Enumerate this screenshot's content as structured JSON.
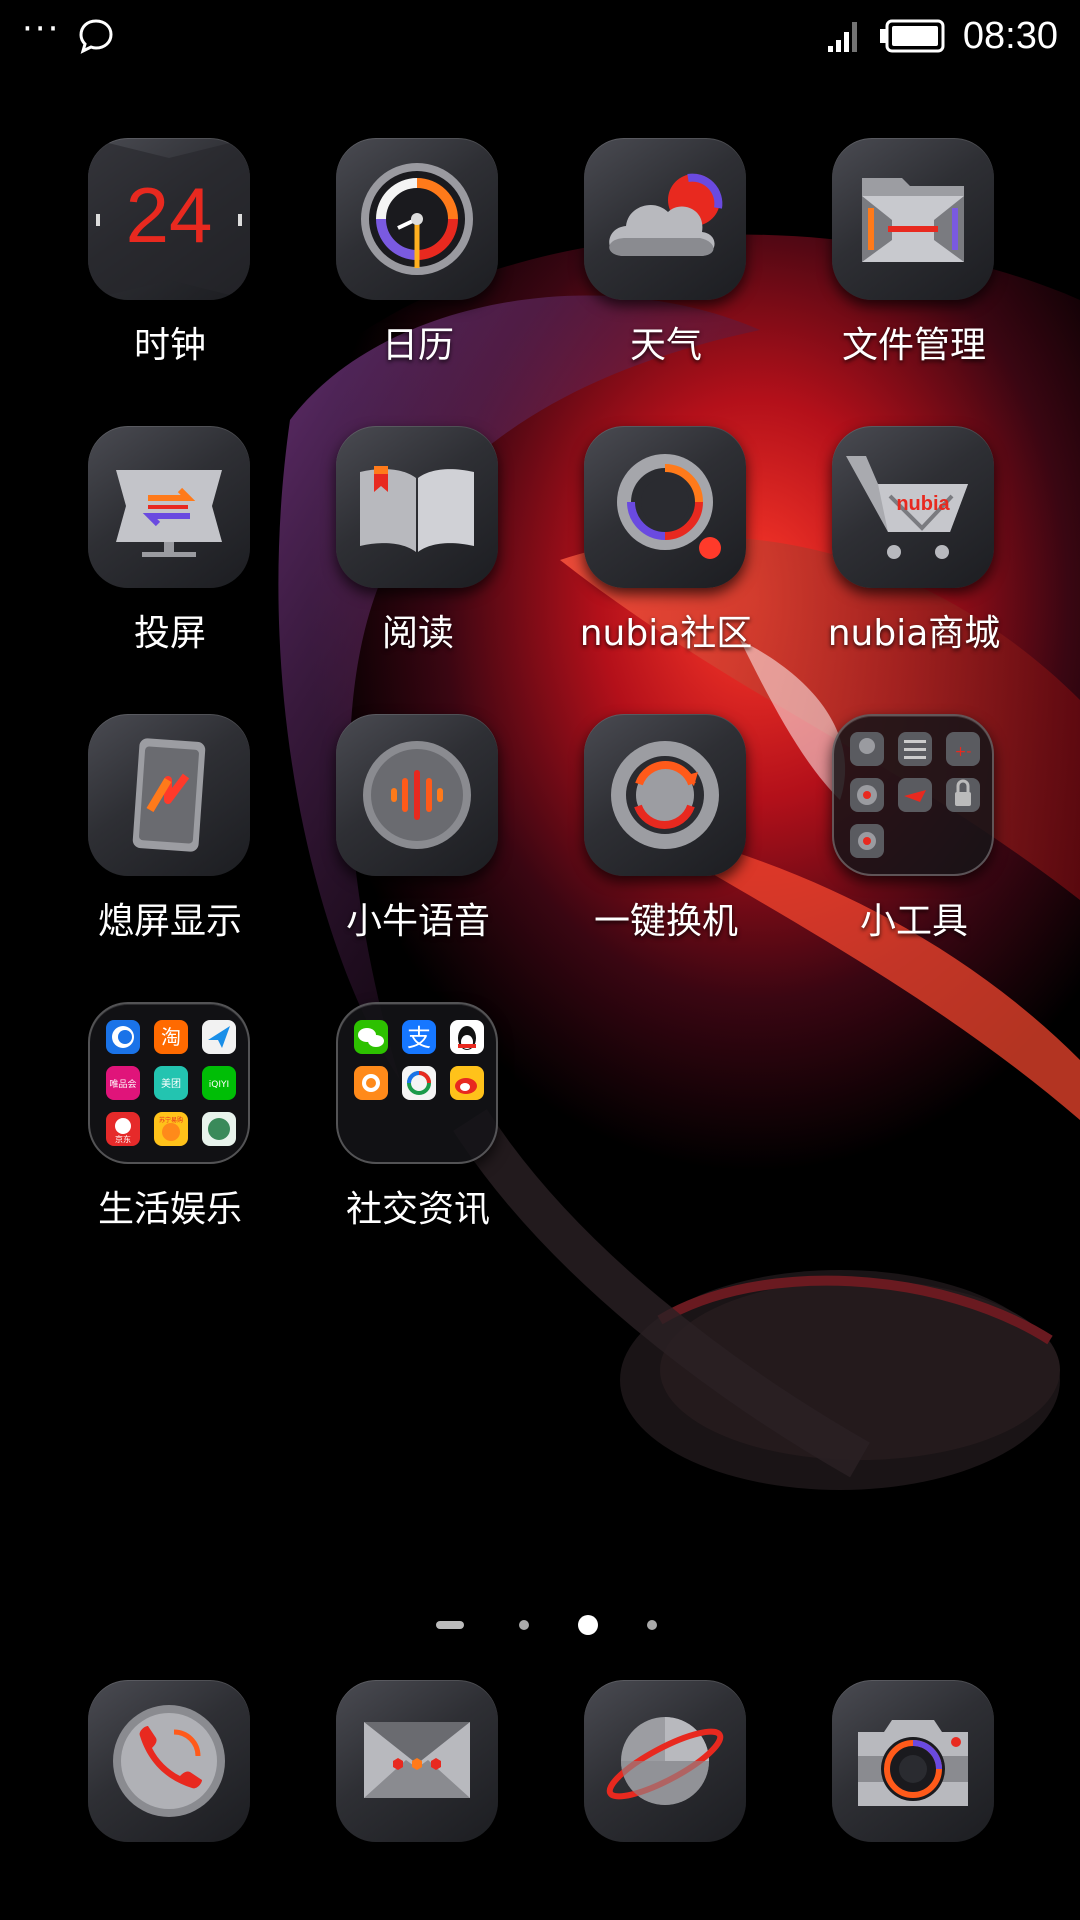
{
  "status_bar": {
    "time": "08:30",
    "left_icons": [
      "more-dots-icon",
      "chat-bubble-icon"
    ],
    "right_icons": [
      "signal-icon",
      "battery-icon"
    ],
    "battery_level": 1.0
  },
  "apps": [
    {
      "label": "时钟",
      "icon": "clock-icon",
      "icon_text": "24"
    },
    {
      "label": "日历",
      "icon": "calendar-icon"
    },
    {
      "label": "天气",
      "icon": "weather-icon"
    },
    {
      "label": "文件管理",
      "icon": "file-manager-icon"
    },
    {
      "label": "投屏",
      "icon": "screen-cast-icon"
    },
    {
      "label": "阅读",
      "icon": "reader-icon"
    },
    {
      "label": "nubia社区",
      "icon": "community-icon"
    },
    {
      "label": "nubia商城",
      "icon": "shop-cart-icon",
      "icon_text": "nubia"
    },
    {
      "label": "熄屏显示",
      "icon": "ambient-display-icon"
    },
    {
      "label": "小牛语音",
      "icon": "voice-assistant-icon"
    },
    {
      "label": "一键换机",
      "icon": "phone-clone-icon"
    },
    {
      "label": "小工具",
      "icon": "tools-folder-icon"
    },
    {
      "label": "生活娱乐",
      "icon": "life-folder-icon"
    },
    {
      "label": "社交资讯",
      "icon": "social-folder-icon"
    }
  ],
  "folders": {
    "life": {
      "mini_labels": [
        "淘",
        "唯品会",
        "美团",
        "iQIYI",
        "京东",
        "苏宁易购"
      ]
    },
    "social": {
      "mini_labels": [
        "支"
      ]
    }
  },
  "page_indicator": {
    "pages": 4,
    "active": 2
  },
  "dock": [
    {
      "icon": "phone-icon"
    },
    {
      "icon": "messages-icon"
    },
    {
      "icon": "browser-icon"
    },
    {
      "icon": "camera-icon"
    }
  ],
  "colors": {
    "accent": "#e8291f",
    "orange": "#ff6a1a",
    "icon_base": "#2e2f34"
  }
}
